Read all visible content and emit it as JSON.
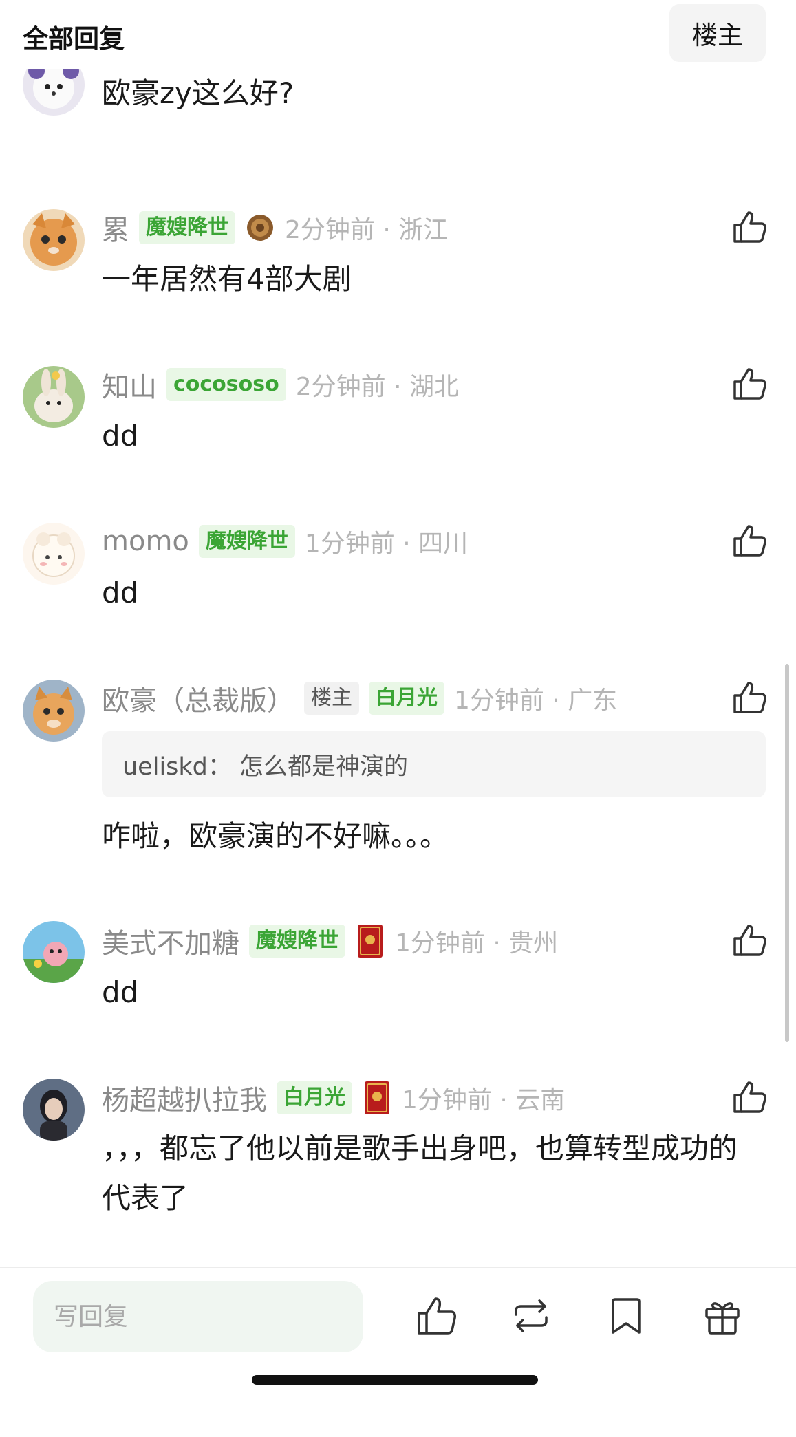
{
  "header": {
    "title": "全部回复",
    "op_button": "楼主"
  },
  "colors": {
    "badge_green": "#3ba535",
    "badge_green_bg": "#e9f7e6",
    "meta_gray": "#8a8a8a",
    "time_gray": "#b5b5b5"
  },
  "comments": [
    {
      "username": "",
      "badges": [],
      "time": "",
      "content": "欧豪zy这么好?",
      "avatar": "white-dog-avatar"
    },
    {
      "username": "累",
      "badges": [
        "魔嫂降世"
      ],
      "medal": "bronze-medal-icon",
      "time": "2分钟前 · 浙江",
      "content": "一年居然有4部大剧",
      "avatar": "orange-cat-avatar"
    },
    {
      "username": "知山",
      "badges": [
        "cocososo"
      ],
      "time": "2分钟前 · 湖北",
      "content": "dd",
      "avatar": "rabbit-avatar"
    },
    {
      "username": "momo",
      "badges": [
        "魔嫂降世"
      ],
      "time": "1分钟前 · 四川",
      "content": "dd",
      "avatar": "sheep-avatar"
    },
    {
      "username": "欧豪（总裁版）",
      "op_badge": "楼主",
      "badges": [
        "白月光"
      ],
      "time": "1分钟前 · 广东",
      "quote": "ueliskd： 怎么都是神演的",
      "content": "咋啦，欧豪演的不好嘛。。。",
      "avatar": "orange-kitten-avatar"
    },
    {
      "username": "美式不加糖",
      "badges": [
        "魔嫂降世"
      ],
      "medal": "red-book-icon",
      "time": "1分钟前 · 贵州",
      "content": "dd",
      "avatar": "cartoon-scene-avatar"
    },
    {
      "username": "杨超越扒拉我",
      "badges": [
        "白月光"
      ],
      "medal": "red-book-icon",
      "time": "1分钟前 · 云南",
      "content": "，，，都忘了他以前是歌手出身吧，也算转型成功的代表了",
      "avatar": "girl-portrait-avatar"
    }
  ],
  "bottom": {
    "reply_placeholder": "写回复"
  }
}
